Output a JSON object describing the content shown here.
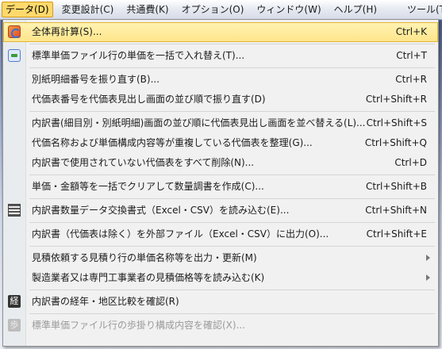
{
  "menubar": {
    "items": [
      {
        "label": "データ(D)",
        "active": true
      },
      {
        "label": "変更設計(C)"
      },
      {
        "label": "共通費(K)"
      },
      {
        "label": "オプション(O)"
      },
      {
        "label": "ウィンドウ(W)"
      },
      {
        "label": "ヘルプ(H)"
      },
      {
        "label": "ツール(T)"
      }
    ]
  },
  "menu": {
    "items": [
      {
        "label": "全体再計算(S)...",
        "shortcut": "Ctrl+K",
        "icon": "recalculate-icon"
      },
      {
        "label": "標準単価ファイル行の単価を一括で入れ替え(T)...",
        "shortcut": "Ctrl+T",
        "icon": "swap-price-icon"
      },
      {
        "label": "別紙明細番号を振り直す(B)...",
        "shortcut": "Ctrl+R"
      },
      {
        "label": "代価表番号を代価表見出し画面の並び順で振り直す(D)",
        "shortcut": "Ctrl+Shift+R"
      },
      {
        "label": "内訳書(細目別・別紙明細)画面の並び順に代価表見出し画面を並べ替える(L)...",
        "shortcut": "Ctrl+Shift+S"
      },
      {
        "label": "代価名称および単価構成内容等が重複している代価表を整理(G)...",
        "shortcut": "Ctrl+Shift+Q"
      },
      {
        "label": "内訳書で使用されていない代価表をすべて削除(N)...",
        "shortcut": "Ctrl+D"
      },
      {
        "label": "単価・金額等を一括でクリアして数量調書を作成(C)...",
        "shortcut": "Ctrl+Shift+B"
      },
      {
        "label": "内訳書数量データ交換書式（Excel・CSV）を読み込む(E)...",
        "shortcut": "Ctrl+Shift+N",
        "icon": "data-exchange-icon"
      },
      {
        "label": "内訳書（代価表は除く）を外部ファイル（Excel・CSV）に出力(O)...",
        "shortcut": "Ctrl+Shift+E"
      },
      {
        "label": "見積依頼する見積り行の単価名称等を出力・更新(M)"
      },
      {
        "label": "製造業者又は専門工事業者の見積価格等を読み込む(K)"
      },
      {
        "label": "内訳書の経年・地区比較を確認(R)",
        "icon": "compare-icon",
        "icon_glyph": "経"
      },
      {
        "label": "標準単価ファイル行の歩掛り構成内容を確認(X)...",
        "icon": "breakdown-icon",
        "icon_glyph": "歩"
      }
    ]
  }
}
